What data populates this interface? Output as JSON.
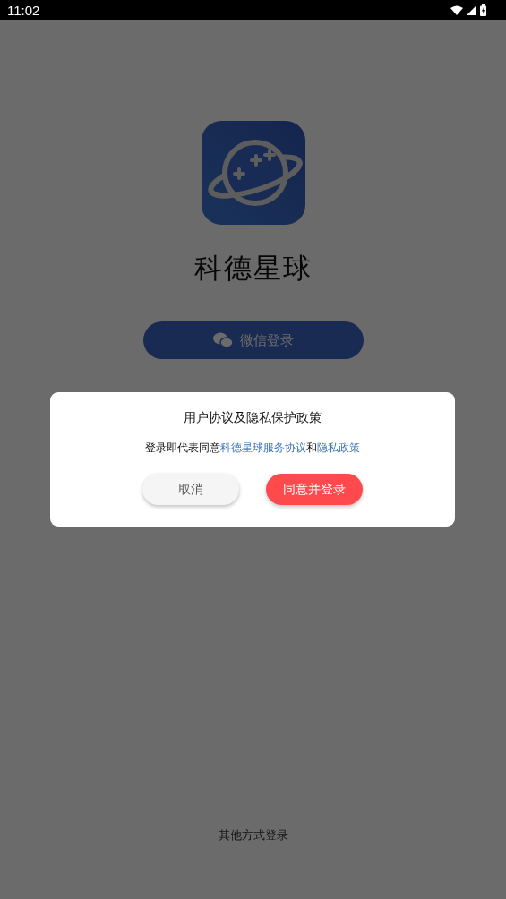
{
  "status_bar": {
    "time": "11:02"
  },
  "app": {
    "name": "科德星球"
  },
  "login_button": {
    "label": "微信登录"
  },
  "other_login": "其他方式登录",
  "dialog": {
    "title": "用户协议及隐私保护政策",
    "message": [
      {
        "kind": "text",
        "text": "登录即代表同意"
      },
      {
        "kind": "link",
        "text": "科德星球服务协议"
      },
      {
        "kind": "text",
        "text": "和"
      },
      {
        "kind": "link",
        "text": "隐私政策"
      }
    ],
    "buttons": [
      {
        "kind": "secondary",
        "label": "取消"
      },
      {
        "kind": "primary",
        "label": "同意并登录"
      }
    ]
  }
}
